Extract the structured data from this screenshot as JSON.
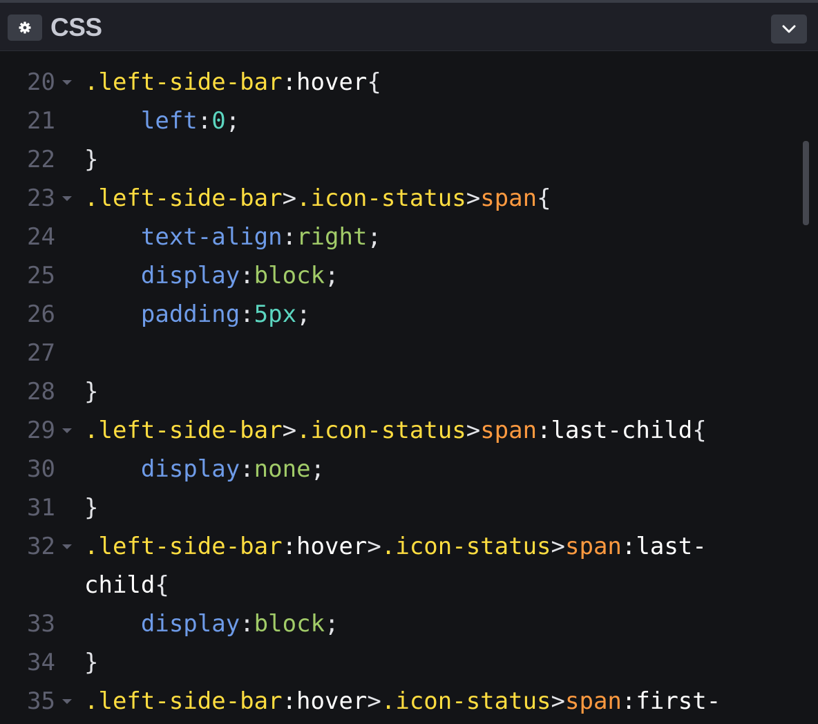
{
  "header": {
    "title": "CSS",
    "settings_icon": "gear-icon",
    "collapse_icon": "chevron-down-icon"
  },
  "colors": {
    "background": "#131417",
    "header": "#1e1f26",
    "selector": "#ffdd40",
    "tag": "#ff9a40",
    "property": "#6e9be8",
    "value": "#a2cc69",
    "number": "#5cd6c0",
    "line_number": "#5e6070"
  },
  "lines": [
    {
      "num": "20",
      "fold": true,
      "tokens": [
        {
          "t": ".left-side-bar",
          "c": "sel"
        },
        {
          "t": ":hover",
          "c": "pseudo"
        },
        {
          "t": "{",
          "c": "punc"
        }
      ]
    },
    {
      "num": "21",
      "fold": false,
      "tokens": [
        {
          "t": "    ",
          "c": "punc"
        },
        {
          "t": "left",
          "c": "prop"
        },
        {
          "t": ":",
          "c": "punc"
        },
        {
          "t": "0",
          "c": "num"
        },
        {
          "t": ";",
          "c": "punc"
        }
      ]
    },
    {
      "num": "22",
      "fold": false,
      "tokens": [
        {
          "t": "}",
          "c": "punc"
        }
      ]
    },
    {
      "num": "23",
      "fold": true,
      "tokens": [
        {
          "t": ".left-side-bar",
          "c": "sel"
        },
        {
          "t": ">",
          "c": "punc"
        },
        {
          "t": ".icon-status",
          "c": "sel"
        },
        {
          "t": ">",
          "c": "punc"
        },
        {
          "t": "span",
          "c": "tag"
        },
        {
          "t": "{",
          "c": "punc"
        }
      ]
    },
    {
      "num": "24",
      "fold": false,
      "tokens": [
        {
          "t": "    ",
          "c": "punc"
        },
        {
          "t": "text-align",
          "c": "prop"
        },
        {
          "t": ":",
          "c": "punc"
        },
        {
          "t": "right",
          "c": "val"
        },
        {
          "t": ";",
          "c": "punc"
        }
      ]
    },
    {
      "num": "25",
      "fold": false,
      "tokens": [
        {
          "t": "    ",
          "c": "punc"
        },
        {
          "t": "display",
          "c": "prop"
        },
        {
          "t": ":",
          "c": "punc"
        },
        {
          "t": "block",
          "c": "val"
        },
        {
          "t": ";",
          "c": "punc"
        }
      ]
    },
    {
      "num": "26",
      "fold": false,
      "tokens": [
        {
          "t": "    ",
          "c": "punc"
        },
        {
          "t": "padding",
          "c": "prop"
        },
        {
          "t": ":",
          "c": "punc"
        },
        {
          "t": "5px",
          "c": "num"
        },
        {
          "t": ";",
          "c": "punc"
        }
      ]
    },
    {
      "num": "27",
      "fold": false,
      "tokens": []
    },
    {
      "num": "28",
      "fold": false,
      "tokens": [
        {
          "t": "}",
          "c": "punc"
        }
      ]
    },
    {
      "num": "29",
      "fold": true,
      "tokens": [
        {
          "t": ".left-side-bar",
          "c": "sel"
        },
        {
          "t": ">",
          "c": "punc"
        },
        {
          "t": ".icon-status",
          "c": "sel"
        },
        {
          "t": ">",
          "c": "punc"
        },
        {
          "t": "span",
          "c": "tag"
        },
        {
          "t": ":last-child",
          "c": "pseudo"
        },
        {
          "t": "{",
          "c": "punc"
        }
      ]
    },
    {
      "num": "30",
      "fold": false,
      "tokens": [
        {
          "t": "    ",
          "c": "punc"
        },
        {
          "t": "display",
          "c": "prop"
        },
        {
          "t": ":",
          "c": "punc"
        },
        {
          "t": "none",
          "c": "val"
        },
        {
          "t": ";",
          "c": "punc"
        }
      ]
    },
    {
      "num": "31",
      "fold": false,
      "tokens": [
        {
          "t": "}",
          "c": "punc"
        }
      ]
    },
    {
      "num": "32",
      "fold": true,
      "tokens": [
        {
          "t": ".left-side-bar",
          "c": "sel"
        },
        {
          "t": ":hover",
          "c": "pseudo"
        },
        {
          "t": ">",
          "c": "punc"
        },
        {
          "t": ".icon-status",
          "c": "sel"
        },
        {
          "t": ">",
          "c": "punc"
        },
        {
          "t": "span",
          "c": "tag"
        },
        {
          "t": ":last-",
          "c": "pseudo"
        }
      ]
    },
    {
      "num": "",
      "fold": false,
      "tokens": [
        {
          "t": "child",
          "c": "pseudo"
        },
        {
          "t": "{",
          "c": "punc"
        }
      ]
    },
    {
      "num": "33",
      "fold": false,
      "tokens": [
        {
          "t": "    ",
          "c": "punc"
        },
        {
          "t": "display",
          "c": "prop"
        },
        {
          "t": ":",
          "c": "punc"
        },
        {
          "t": "block",
          "c": "val"
        },
        {
          "t": ";",
          "c": "punc"
        }
      ]
    },
    {
      "num": "34",
      "fold": false,
      "tokens": [
        {
          "t": "}",
          "c": "punc"
        }
      ]
    },
    {
      "num": "35",
      "fold": true,
      "tokens": [
        {
          "t": ".left-side-bar",
          "c": "sel"
        },
        {
          "t": ":hover",
          "c": "pseudo"
        },
        {
          "t": ">",
          "c": "punc"
        },
        {
          "t": ".icon-status",
          "c": "sel"
        },
        {
          "t": ">",
          "c": "punc"
        },
        {
          "t": "span",
          "c": "tag"
        },
        {
          "t": ":first-",
          "c": "pseudo"
        }
      ]
    }
  ]
}
